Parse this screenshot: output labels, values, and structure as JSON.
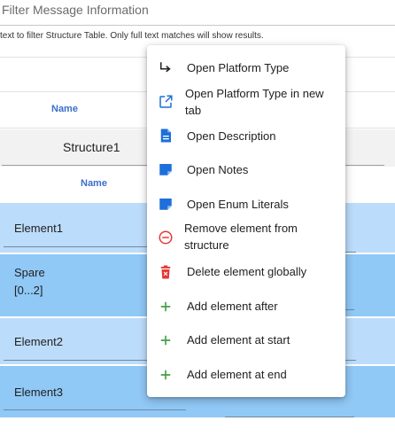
{
  "filter": {
    "label": "Filter Message Information",
    "hint": "text to filter Structure Table. Only full text matches will show results."
  },
  "table": {
    "header_name": "Name",
    "structure": {
      "name": "Structure1",
      "sub_header_name": "Name"
    },
    "rows": [
      {
        "name": "Element1"
      },
      {
        "name": "Spare",
        "detail": "[0...2]"
      },
      {
        "name": "Element2"
      },
      {
        "name": "Element3"
      }
    ]
  },
  "context_menu": {
    "items": [
      {
        "label": "Open Platform Type",
        "icon": "subdirectory-arrow-icon"
      },
      {
        "label": "Open Platform Type in new tab",
        "icon": "open-in-new-icon"
      },
      {
        "label": "Open Description",
        "icon": "description-icon"
      },
      {
        "label": "Open Notes",
        "icon": "note-icon"
      },
      {
        "label": "Open Enum Literals",
        "icon": "note-icon"
      },
      {
        "label": "Remove element from structure",
        "icon": "remove-circle-icon"
      },
      {
        "label": "Delete element globally",
        "icon": "trash-icon"
      },
      {
        "label": "Add element after",
        "icon": "plus-icon"
      },
      {
        "label": "Add element at start",
        "icon": "plus-icon"
      },
      {
        "label": "Add element at end",
        "icon": "plus-icon"
      }
    ]
  },
  "colors": {
    "accent_blue": "#3a6ec9",
    "row_light": "#bcdcfb",
    "row_dark": "#90c8f6",
    "danger_red": "#e53935",
    "add_green": "#43a047",
    "icon_blue": "#1e6fd9"
  }
}
